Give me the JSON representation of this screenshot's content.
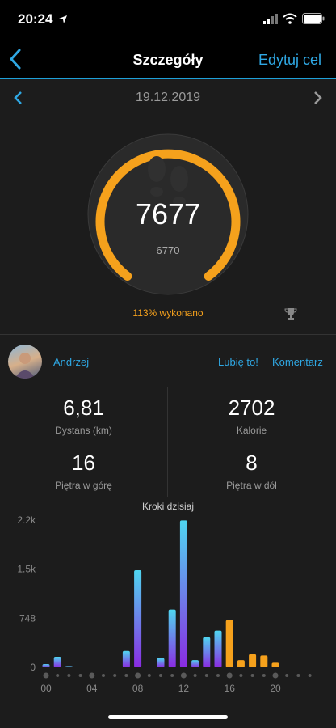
{
  "status_bar": {
    "time": "20:24"
  },
  "nav": {
    "title": "Szczegóły",
    "edit_label": "Edytuj cel"
  },
  "date": "19.12.2019",
  "ring": {
    "steps": "7677",
    "goal": "6770",
    "completion_text": "113% wykonano",
    "progress_fraction": 1.0
  },
  "social": {
    "user": "Andrzej",
    "like": "Lubię to!",
    "comment": "Komentarz"
  },
  "stats": [
    {
      "value": "6,81",
      "label": "Dystans (km)"
    },
    {
      "value": "2702",
      "label": "Kalorie"
    },
    {
      "value": "16",
      "label": "Piętra w górę"
    },
    {
      "value": "8",
      "label": "Piętra w dół"
    }
  ],
  "colors": {
    "accent": "#f5a11c",
    "link": "#2fa8e4",
    "bar_past_top": "#4fd6f0",
    "bar_past_bottom": "#8a2be2"
  },
  "chart_data": {
    "type": "bar",
    "title": "Kroki dzisiaj",
    "ylim": [
      0,
      2244
    ],
    "y_ticks": [
      "2.2k",
      "1.5k",
      "748",
      "0"
    ],
    "x_ticks": [
      "00",
      "04",
      "08",
      "12",
      "16",
      "20"
    ],
    "series": [
      {
        "values": [
          50,
          160,
          20,
          0,
          0,
          0,
          0,
          250,
          1480,
          0,
          140,
          880,
          2240,
          110,
          460,
          560,
          0,
          0,
          0,
          0,
          0
        ]
      },
      {
        "values": [
          0,
          0,
          0,
          0,
          0,
          0,
          0,
          0,
          0,
          0,
          0,
          0,
          0,
          0,
          0,
          0,
          720,
          110,
          200,
          180,
          70
        ]
      }
    ]
  }
}
